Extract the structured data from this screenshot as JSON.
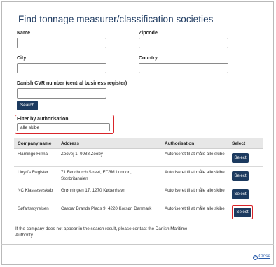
{
  "dialog": {
    "title": "Find tonnage measurer/classification societies"
  },
  "form": {
    "name_label": "Name",
    "name_value": "",
    "zipcode_label": "Zipcode",
    "zipcode_value": "",
    "city_label": "City",
    "city_value": "",
    "country_label": "Country",
    "country_value": "",
    "cvr_label": "Danish CVR number (central business register)",
    "cvr_value": "",
    "search_label": "Search",
    "filter_label": "Filter by authorisation",
    "filter_value": "alle skibe"
  },
  "table": {
    "headers": [
      "Company name",
      "Address",
      "Authorisation",
      "Select"
    ],
    "rows": [
      {
        "company": "Flamingo Firma",
        "address": "Zoovej 1, 9988 Zooby",
        "authorisation": "Autoriseret til at måle alle skibe",
        "select": "Select"
      },
      {
        "company": "Lloyd's Register",
        "address": "71 Fenchurch Street, EC3M London, Storbritannien",
        "authorisation": "Autoriseret til at måle alle skibe",
        "select": "Select"
      },
      {
        "company": "NC Klasseselskab",
        "address": "Grønningen 17, 1270 København",
        "authorisation": "Autoriseret til at måle alle skibe",
        "select": "Select"
      },
      {
        "company": "Søfartsstyrelsen",
        "address": "Caspar Brands Plads 9, 4220 Korsør, Danmark",
        "authorisation": "Autoriseret til at måle alle skibe",
        "select": "Select"
      }
    ]
  },
  "notice": "If the company does not appear in the search result, please contact the Danish Maritime Authority.",
  "footer": {
    "close_label": "Close",
    "close_icon": "close-circle-icon"
  },
  "colors": {
    "title": "#1f3b61",
    "button": "#1c3a5f",
    "highlight": "#d9252a",
    "link": "#2a5caa"
  }
}
